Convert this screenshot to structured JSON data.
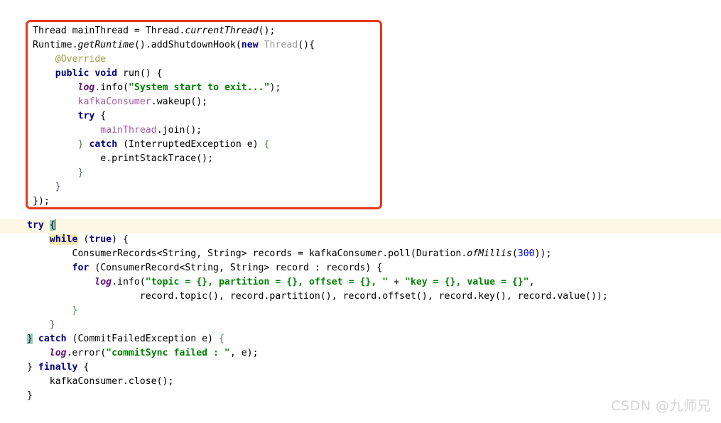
{
  "page": {
    "background": "#ffffff",
    "watermark": "CSDN @九师兄",
    "annotation_box_color": "#e8381a",
    "caret_line_highlight_color": "#fdf8e3",
    "brace_match_highlight_color": "#93cfc2"
  },
  "code_block_1": {
    "name": "shutdown-hook-snippet",
    "boxed": true,
    "lines": [
      {
        "id": "b1l1",
        "tokens": [
          {
            "t": "Thread mainThread = Thread.",
            "c": "plain"
          },
          {
            "t": "currentThread",
            "c": "method-i"
          },
          {
            "t": "();",
            "c": "plain"
          }
        ]
      },
      {
        "id": "b1l2",
        "tokens": [
          {
            "t": "Runtime.",
            "c": "plain"
          },
          {
            "t": "getRuntime",
            "c": "method-i"
          },
          {
            "t": "().addShutdownHook(",
            "c": "plain"
          },
          {
            "t": "new",
            "c": "kw"
          },
          {
            "t": " ",
            "c": "plain"
          },
          {
            "t": "Thread",
            "c": "grey"
          },
          {
            "t": "(){",
            "c": "plain"
          }
        ]
      },
      {
        "id": "b1l3",
        "tokens": [
          {
            "t": "    ",
            "c": "plain"
          },
          {
            "t": "@Override",
            "c": "anno"
          }
        ]
      },
      {
        "id": "b1l4",
        "tokens": [
          {
            "t": "    ",
            "c": "plain"
          },
          {
            "t": "public void",
            "c": "kw"
          },
          {
            "t": " run() {",
            "c": "plain"
          }
        ]
      },
      {
        "id": "b1l5",
        "tokens": [
          {
            "t": "        ",
            "c": "plain"
          },
          {
            "t": "log",
            "c": "field"
          },
          {
            "t": ".info(",
            "c": "plain"
          },
          {
            "t": "\"System start to exit...\"",
            "c": "str"
          },
          {
            "t": ");",
            "c": "plain"
          }
        ]
      },
      {
        "id": "b1l6",
        "tokens": [
          {
            "t": "        ",
            "c": "plain"
          },
          {
            "t": "kafkaConsumer",
            "c": "ivar"
          },
          {
            "t": ".wakeup();",
            "c": "plain"
          }
        ]
      },
      {
        "id": "b1l7",
        "tokens": [
          {
            "t": "        ",
            "c": "plain"
          },
          {
            "t": "try",
            "c": "kw"
          },
          {
            "t": " {",
            "c": "plain"
          }
        ]
      },
      {
        "id": "b1l8",
        "tokens": [
          {
            "t": "            ",
            "c": "plain"
          },
          {
            "t": "mainThread",
            "c": "ivar"
          },
          {
            "t": ".join();",
            "c": "plain"
          }
        ]
      },
      {
        "id": "b1l9",
        "tokens": [
          {
            "t": "        ",
            "c": "plain"
          },
          {
            "t": "}",
            "c": "brace"
          },
          {
            "t": " ",
            "c": "plain"
          },
          {
            "t": "catch",
            "c": "kw"
          },
          {
            "t": " (InterruptedException e) ",
            "c": "plain"
          },
          {
            "t": "{",
            "c": "brace"
          }
        ]
      },
      {
        "id": "b1l10",
        "tokens": [
          {
            "t": "            e.printStackTrace();",
            "c": "plain"
          }
        ]
      },
      {
        "id": "b1l11",
        "tokens": [
          {
            "t": "        ",
            "c": "plain"
          },
          {
            "t": "}",
            "c": "brace"
          }
        ]
      },
      {
        "id": "b1l12",
        "tokens": [
          {
            "t": "    ",
            "c": "plain"
          },
          {
            "t": "}",
            "c": "paren"
          }
        ]
      },
      {
        "id": "b1l13",
        "tokens": [
          {
            "t": "});",
            "c": "plain"
          }
        ]
      }
    ]
  },
  "code_block_2": {
    "name": "consumer-poll-loop-snippet",
    "boxed": false,
    "lines": [
      {
        "id": "b2l1",
        "highlighted": true,
        "tokens": [
          {
            "t": "try",
            "c": "kw"
          },
          {
            "t": " ",
            "c": "plain"
          },
          {
            "t": "{",
            "c": "brace-hl"
          },
          {
            "t": "CARET",
            "c": "caret"
          }
        ]
      },
      {
        "id": "b2l2",
        "tokens": [
          {
            "t": "    ",
            "c": "plain"
          },
          {
            "t": "while",
            "c": "kw ident-hl"
          },
          {
            "t": " (",
            "c": "plain"
          },
          {
            "t": "true",
            "c": "kw"
          },
          {
            "t": ") {",
            "c": "plain"
          }
        ]
      },
      {
        "id": "b2l3",
        "tokens": [
          {
            "t": "        ConsumerRecords<String, String> records = kafkaConsumer.poll(Duration.",
            "c": "plain"
          },
          {
            "t": "ofMillis",
            "c": "method-i"
          },
          {
            "t": "(",
            "c": "plain"
          },
          {
            "t": "300",
            "c": "num"
          },
          {
            "t": "));",
            "c": "plain"
          }
        ]
      },
      {
        "id": "b2l4",
        "tokens": [
          {
            "t": "        ",
            "c": "plain"
          },
          {
            "t": "for",
            "c": "kw"
          },
          {
            "t": " (ConsumerRecord<String, String> record : records) {",
            "c": "plain"
          }
        ]
      },
      {
        "id": "b2l5",
        "tokens": [
          {
            "t": "            ",
            "c": "plain"
          },
          {
            "t": "log",
            "c": "field"
          },
          {
            "t": ".info(",
            "c": "plain"
          },
          {
            "t": "\"topic = {}, partition = {}, offset = {}, \"",
            "c": "str"
          },
          {
            "t": " + ",
            "c": "plain"
          },
          {
            "t": "\"key = {}, value = {}\"",
            "c": "str"
          },
          {
            "t": ",",
            "c": "plain"
          }
        ]
      },
      {
        "id": "b2l6",
        "tokens": [
          {
            "t": "                    record.topic(), record.partition(), record.offset(), record.key(), record.value());",
            "c": "plain"
          }
        ]
      },
      {
        "id": "b2l7",
        "tokens": [
          {
            "t": "        ",
            "c": "plain"
          },
          {
            "t": "}",
            "c": "brace"
          }
        ]
      },
      {
        "id": "b2l8",
        "tokens": [
          {
            "t": "    ",
            "c": "plain"
          },
          {
            "t": "}",
            "c": "paren"
          }
        ]
      },
      {
        "id": "b2l9",
        "tokens": [
          {
            "t": "}",
            "c": "brace-hl"
          },
          {
            "t": " ",
            "c": "plain"
          },
          {
            "t": "catch",
            "c": "kw"
          },
          {
            "t": " (CommitFailedException e) ",
            "c": "plain"
          },
          {
            "t": "{",
            "c": "brace"
          }
        ]
      },
      {
        "id": "b2l10",
        "tokens": [
          {
            "t": "    ",
            "c": "plain"
          },
          {
            "t": "log",
            "c": "field"
          },
          {
            "t": ".error(",
            "c": "plain"
          },
          {
            "t": "\"commitSync failed : \"",
            "c": "str"
          },
          {
            "t": ", e);",
            "c": "plain"
          }
        ]
      },
      {
        "id": "b2l11",
        "tokens": [
          {
            "t": "} ",
            "c": "plain"
          },
          {
            "t": "finally",
            "c": "kw"
          },
          {
            "t": " {",
            "c": "plain"
          }
        ]
      },
      {
        "id": "b2l12",
        "tokens": [
          {
            "t": "    kafkaConsumer.close();",
            "c": "plain"
          }
        ]
      },
      {
        "id": "b2l13",
        "tokens": [
          {
            "t": "}",
            "c": "plain"
          }
        ]
      }
    ]
  }
}
